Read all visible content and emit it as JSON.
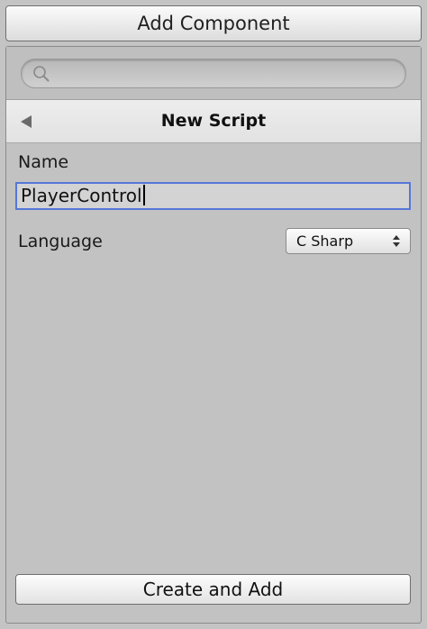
{
  "window": {
    "add_component_label": "Add Component"
  },
  "search": {
    "value": "",
    "placeholder": "",
    "icon": "search-icon"
  },
  "header": {
    "title": "New Script",
    "back_icon": "back-arrow-icon"
  },
  "form": {
    "name_label": "Name",
    "name_value": "PlayerControl",
    "language_label": "Language",
    "language_value": "C Sharp",
    "language_icon": "updown-arrows-icon"
  },
  "footer": {
    "create_label": "Create and Add"
  },
  "colors": {
    "focus_border": "#5577d8",
    "panel_background": "#c2c2c2"
  }
}
